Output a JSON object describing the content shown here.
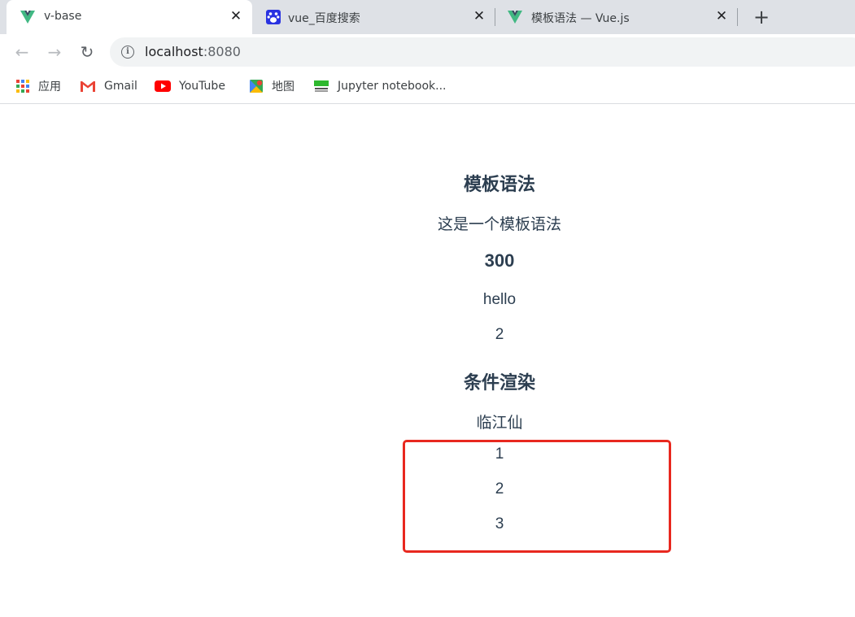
{
  "browser": {
    "tabs": [
      {
        "title": "v-base",
        "icon": "vue-logo-icon",
        "active": true
      },
      {
        "title": "vue_百度搜索",
        "icon": "baidu-paw-icon",
        "active": false
      },
      {
        "title": "模板语法 — Vue.js",
        "icon": "vue-logo-icon",
        "active": false
      }
    ],
    "close_glyph": "✕",
    "new_tab_glyph": "+",
    "address": {
      "host": "localhost",
      "port": ":8080"
    },
    "nav": {
      "back": "←",
      "forward": "→",
      "reload": "↻",
      "info": "i"
    },
    "bookmarks": [
      {
        "label": "应用",
        "icon": "apps-grid-icon"
      },
      {
        "label": "Gmail",
        "icon": "gmail-icon"
      },
      {
        "label": "YouTube",
        "icon": "youtube-icon"
      },
      {
        "label": "地图",
        "icon": "maps-icon"
      },
      {
        "label": "Jupyter notebook...",
        "icon": "jupyter-icon"
      }
    ]
  },
  "page": {
    "heading_template": "模板语法",
    "message": "这是一个模板语法",
    "number_heading": "300",
    "greeting": "hello",
    "count": "2",
    "heading_conditional": "条件渲染",
    "poem": "临江仙",
    "list": [
      "1",
      "2",
      "3"
    ]
  },
  "colors": {
    "text": "#2c3e50",
    "highlight_border": "#e8281f",
    "vue_green": "#41b883",
    "vue_dark": "#35495e"
  }
}
